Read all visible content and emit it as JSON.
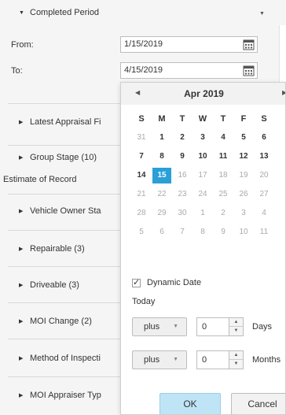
{
  "filter": {
    "completed_period": {
      "label": "Completed Period",
      "from_label": "From:",
      "from_value": "1/15/2019",
      "to_label": "To:",
      "to_value": "4/15/2019"
    },
    "sections": [
      {
        "label": "Latest Appraisal Fi"
      },
      {
        "label": "Group Stage (10)"
      },
      {
        "label": "Vehicle Owner Sta"
      },
      {
        "label": "Repairable (3)"
      },
      {
        "label": "Driveable (3)"
      },
      {
        "label": "MOI Change (2)"
      },
      {
        "label": "Method of Inspecti"
      },
      {
        "label": "MOI Appraiser Typ"
      }
    ],
    "estimate_of_record": "Estimate of Record"
  },
  "calendar": {
    "month_title": "Apr 2019",
    "dow": [
      "S",
      "M",
      "T",
      "W",
      "T",
      "F",
      "S"
    ],
    "weeks": [
      [
        "31",
        "1",
        "2",
        "3",
        "4",
        "5",
        "6"
      ],
      [
        "7",
        "8",
        "9",
        "10",
        "11",
        "12",
        "13"
      ],
      [
        "14",
        "15",
        "16",
        "17",
        "18",
        "19",
        "20"
      ],
      [
        "21",
        "22",
        "23",
        "24",
        "25",
        "26",
        "27"
      ],
      [
        "28",
        "29",
        "30",
        "1",
        "2",
        "3",
        "4"
      ],
      [
        "5",
        "6",
        "7",
        "8",
        "9",
        "10",
        "11"
      ]
    ],
    "selected_day": "15"
  },
  "dynamic": {
    "dynamic_date_label": "Dynamic Date",
    "dynamic_date_checked": true,
    "today_label": "Today",
    "days": {
      "op": "plus",
      "value": "0",
      "unit": "Days"
    },
    "months": {
      "op": "plus",
      "value": "0",
      "unit": "Months"
    }
  },
  "buttons": {
    "ok": "OK",
    "cancel": "Cancel"
  },
  "colors": {
    "selected_day": "#2a9fd8",
    "ok_button": "#bfe4f6"
  }
}
